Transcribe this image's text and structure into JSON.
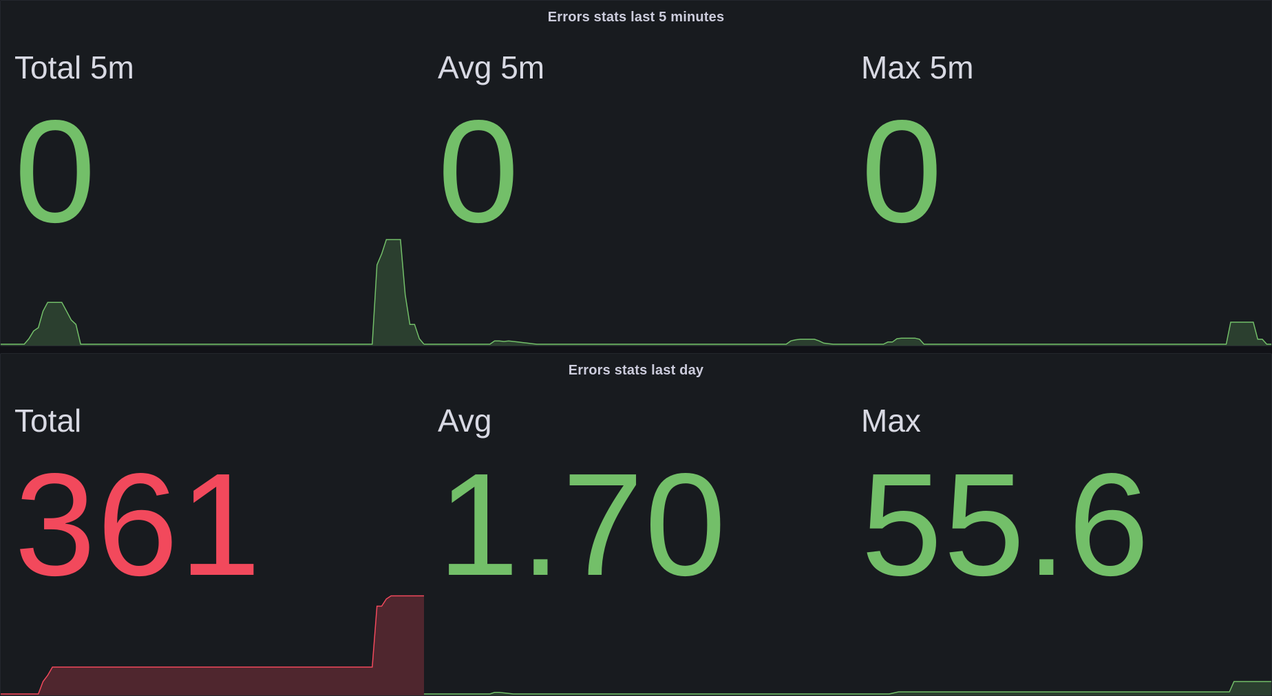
{
  "colors": {
    "green": "#73bf69",
    "red": "#f2495c",
    "green_fill": "rgba(115,191,105,0.22)",
    "red_fill": "rgba(242,73,92,0.25)"
  },
  "panels": [
    {
      "title": "Errors stats last 5 minutes",
      "stats": [
        {
          "label": "Total 5m",
          "value": "0",
          "color": "#73bf69",
          "sparkline": [
            0,
            0,
            0,
            0,
            0,
            0,
            0.05,
            0.12,
            0.15,
            0.3,
            0.38,
            0.38,
            0.38,
            0.38,
            0.3,
            0.22,
            0.18,
            0,
            0,
            0,
            0,
            0,
            0,
            0,
            0,
            0,
            0,
            0,
            0,
            0,
            0,
            0,
            0,
            0,
            0,
            0,
            0,
            0,
            0,
            0,
            0,
            0,
            0,
            0,
            0,
            0,
            0,
            0,
            0,
            0,
            0,
            0,
            0,
            0,
            0,
            0,
            0,
            0,
            0,
            0,
            0,
            0,
            0,
            0,
            0,
            0,
            0,
            0,
            0,
            0,
            0,
            0,
            0,
            0,
            0,
            0,
            0,
            0,
            0,
            0,
            0.72,
            0.82,
            0.95,
            0.95,
            0.95,
            0.95,
            0.45,
            0.18,
            0.18,
            0.05,
            0
          ]
        },
        {
          "label": "Avg 5m",
          "value": "0",
          "color": "#73bf69",
          "sparkline": [
            0,
            0,
            0,
            0,
            0,
            0,
            0,
            0,
            0,
            0,
            0,
            0,
            0,
            0,
            0,
            0.03,
            0.03,
            0.025,
            0.03,
            0.025,
            0.02,
            0.015,
            0.01,
            0.005,
            0,
            0,
            0,
            0,
            0,
            0,
            0,
            0,
            0,
            0,
            0,
            0,
            0,
            0,
            0,
            0,
            0,
            0,
            0,
            0,
            0,
            0,
            0,
            0,
            0,
            0,
            0,
            0,
            0,
            0,
            0,
            0,
            0,
            0,
            0,
            0,
            0,
            0,
            0,
            0,
            0,
            0,
            0,
            0,
            0,
            0,
            0,
            0,
            0,
            0,
            0,
            0,
            0,
            0,
            0.03,
            0.04,
            0.045,
            0.045,
            0.045,
            0.045,
            0.03,
            0.01,
            0.005,
            0,
            0,
            0,
            0
          ]
        },
        {
          "label": "Max 5m",
          "value": "0",
          "color": "#73bf69",
          "sparkline": [
            0,
            0,
            0,
            0,
            0,
            0,
            0,
            0,
            0,
            0.02,
            0.02,
            0.05,
            0.055,
            0.055,
            0.055,
            0.055,
            0.045,
            0,
            0,
            0,
            0,
            0,
            0,
            0,
            0,
            0,
            0,
            0,
            0,
            0,
            0,
            0,
            0,
            0,
            0,
            0,
            0,
            0,
            0,
            0,
            0,
            0,
            0,
            0,
            0,
            0,
            0,
            0,
            0,
            0,
            0,
            0,
            0,
            0,
            0,
            0,
            0,
            0,
            0,
            0,
            0,
            0,
            0,
            0,
            0,
            0,
            0,
            0,
            0,
            0,
            0,
            0,
            0,
            0,
            0,
            0,
            0,
            0,
            0,
            0,
            0,
            0,
            0,
            0,
            0,
            0.2,
            0.2,
            0.2,
            0.2,
            0.2,
            0.2,
            0.045,
            0.045,
            0,
            0
          ]
        }
      ]
    },
    {
      "title": "Errors stats last day",
      "stats": [
        {
          "label": "Total",
          "value": "361",
          "color": "#f2495c",
          "sparkline": [
            0,
            0,
            0,
            0,
            0,
            0,
            0,
            0,
            0,
            0.12,
            0.18,
            0.26,
            0.26,
            0.26,
            0.26,
            0.26,
            0.26,
            0.26,
            0.26,
            0.26,
            0.26,
            0.26,
            0.26,
            0.26,
            0.26,
            0.26,
            0.26,
            0.26,
            0.26,
            0.26,
            0.26,
            0.26,
            0.26,
            0.26,
            0.26,
            0.26,
            0.26,
            0.26,
            0.26,
            0.26,
            0.26,
            0.26,
            0.26,
            0.26,
            0.26,
            0.26,
            0.26,
            0.26,
            0.26,
            0.26,
            0.26,
            0.26,
            0.26,
            0.26,
            0.26,
            0.26,
            0.26,
            0.26,
            0.26,
            0.26,
            0.26,
            0.26,
            0.26,
            0.26,
            0.26,
            0.26,
            0.26,
            0.26,
            0.26,
            0.26,
            0.26,
            0.26,
            0.26,
            0.26,
            0.26,
            0.26,
            0.26,
            0.26,
            0.26,
            0.26,
            0.85,
            0.85,
            0.92,
            0.95,
            0.95,
            0.95,
            0.95,
            0.95,
            0.95,
            0.95,
            0.95
          ]
        },
        {
          "label": "Avg",
          "value": "1.70",
          "color": "#73bf69",
          "sparkline": [
            0,
            0,
            0,
            0,
            0,
            0,
            0,
            0,
            0,
            0,
            0,
            0,
            0,
            0,
            0,
            0.015,
            0.015,
            0.01,
            0.005,
            0,
            0,
            0,
            0,
            0,
            0,
            0,
            0,
            0,
            0,
            0,
            0,
            0,
            0,
            0,
            0,
            0,
            0,
            0,
            0,
            0,
            0,
            0,
            0,
            0,
            0,
            0,
            0,
            0,
            0,
            0,
            0,
            0,
            0,
            0,
            0,
            0,
            0,
            0,
            0,
            0,
            0,
            0,
            0,
            0,
            0,
            0,
            0,
            0,
            0,
            0,
            0,
            0,
            0,
            0,
            0,
            0,
            0,
            0,
            0,
            0,
            0,
            0,
            0,
            0,
            0,
            0,
            0,
            0,
            0,
            0,
            0
          ]
        },
        {
          "label": "Max",
          "value": "55.6",
          "color": "#73bf69",
          "sparkline": [
            0,
            0,
            0,
            0,
            0,
            0,
            0,
            0,
            0,
            0,
            0.01,
            0.02,
            0.02,
            0.02,
            0.02,
            0.02,
            0.02,
            0.02,
            0.02,
            0.02,
            0.02,
            0.02,
            0.02,
            0.02,
            0.02,
            0.02,
            0.02,
            0.02,
            0.02,
            0.02,
            0.02,
            0.02,
            0.02,
            0.02,
            0.02,
            0.02,
            0.02,
            0.02,
            0.02,
            0.02,
            0.02,
            0.02,
            0.02,
            0.02,
            0.02,
            0.02,
            0.02,
            0.02,
            0.02,
            0.02,
            0.02,
            0.02,
            0.02,
            0.02,
            0.02,
            0.02,
            0.02,
            0.02,
            0.02,
            0.02,
            0.02,
            0.02,
            0.02,
            0.02,
            0.02,
            0.02,
            0.02,
            0.02,
            0.02,
            0.02,
            0.02,
            0.02,
            0.02,
            0.02,
            0.02,
            0.02,
            0.02,
            0.02,
            0.02,
            0.02,
            0.02,
            0.02,
            0.02,
            0.12,
            0.12,
            0.12,
            0.12,
            0.12,
            0.12,
            0.12,
            0.12,
            0.12
          ]
        }
      ]
    }
  ]
}
